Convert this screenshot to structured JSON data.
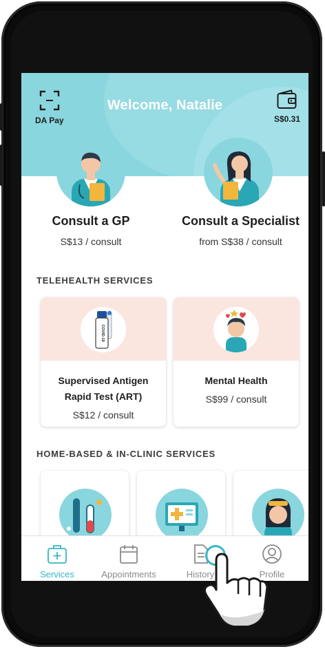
{
  "header": {
    "welcome": "Welcome, Natalie",
    "pay_label": "DA Pay",
    "wallet_balance": "S$0.31"
  },
  "consult": [
    {
      "title": "Consult a GP",
      "price": "S$13 / consult"
    },
    {
      "title": "Consult a Specialist",
      "price": "from S$38 / consult"
    }
  ],
  "telehealth": {
    "section_title": "TELEHEALTH SERVICES",
    "cards": [
      {
        "title_line1": "Supervised Antigen",
        "title_line2": "Rapid Test (ART)",
        "price": "S$12 / consult",
        "kit_text": "COVID-19"
      },
      {
        "title": "Mental Health",
        "price": "S$99 / consult"
      }
    ]
  },
  "home_clinic": {
    "section_title": "HOME-BASED & IN-CLINIC SERVICES"
  },
  "nav": {
    "items": [
      {
        "label": "Services",
        "icon": "medkit-icon",
        "active": true
      },
      {
        "label": "Appointments",
        "icon": "calendar-icon",
        "active": false
      },
      {
        "label": "History",
        "icon": "history-icon",
        "active": false
      },
      {
        "label": "Profile",
        "icon": "profile-icon",
        "active": false
      }
    ]
  },
  "colors": {
    "header_teal": "#8ad6df",
    "accent": "#36b6c4",
    "card_peach": "#fbe6df",
    "nav_inactive": "#8a8a8a"
  }
}
